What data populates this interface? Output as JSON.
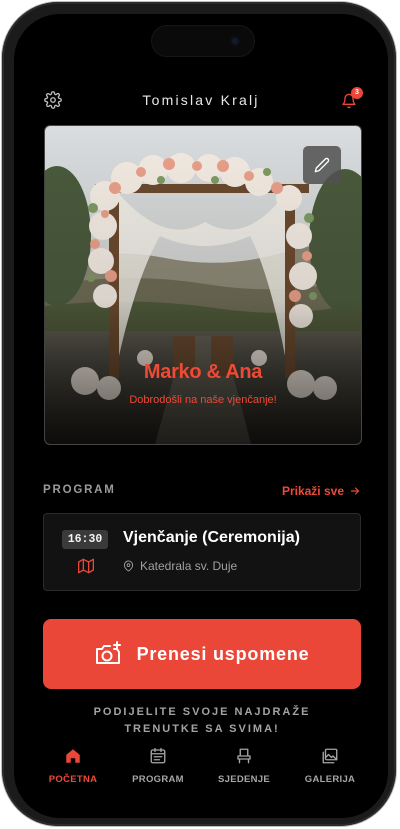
{
  "header": {
    "title": "Tomislav Kralj",
    "notification_count": "3",
    "settings_icon": "gear-icon",
    "notifications_icon": "bell-icon"
  },
  "hero": {
    "couple_names": "Marko & Ana",
    "welcome_text": "Dobrodošli na naše vjenčanje!",
    "edit_icon": "pencil-icon"
  },
  "program": {
    "section_label": "PROGRAM",
    "see_all_label": "Prikaži sve",
    "events": [
      {
        "time": "16:30",
        "title": "Vjenčanje (Ceremonija)",
        "location": "Katedrala sv. Duje"
      }
    ]
  },
  "upload": {
    "label": "Prenesi uspomene",
    "hint": "PODIJELITE SVOJE NAJDRAŽE TRENUTKE SA SVIMA!"
  },
  "nav": {
    "items": [
      {
        "label": "POČETNA",
        "icon": "home-icon",
        "active": true
      },
      {
        "label": "PROGRAM",
        "icon": "calendar-icon",
        "active": false
      },
      {
        "label": "SJEDENJE",
        "icon": "chair-icon",
        "active": false
      },
      {
        "label": "GALERIJA",
        "icon": "gallery-icon",
        "active": false
      }
    ]
  },
  "colors": {
    "accent": "#ea4738",
    "background": "#000000",
    "card": "#121212",
    "muted_text": "#a3a3a3"
  }
}
